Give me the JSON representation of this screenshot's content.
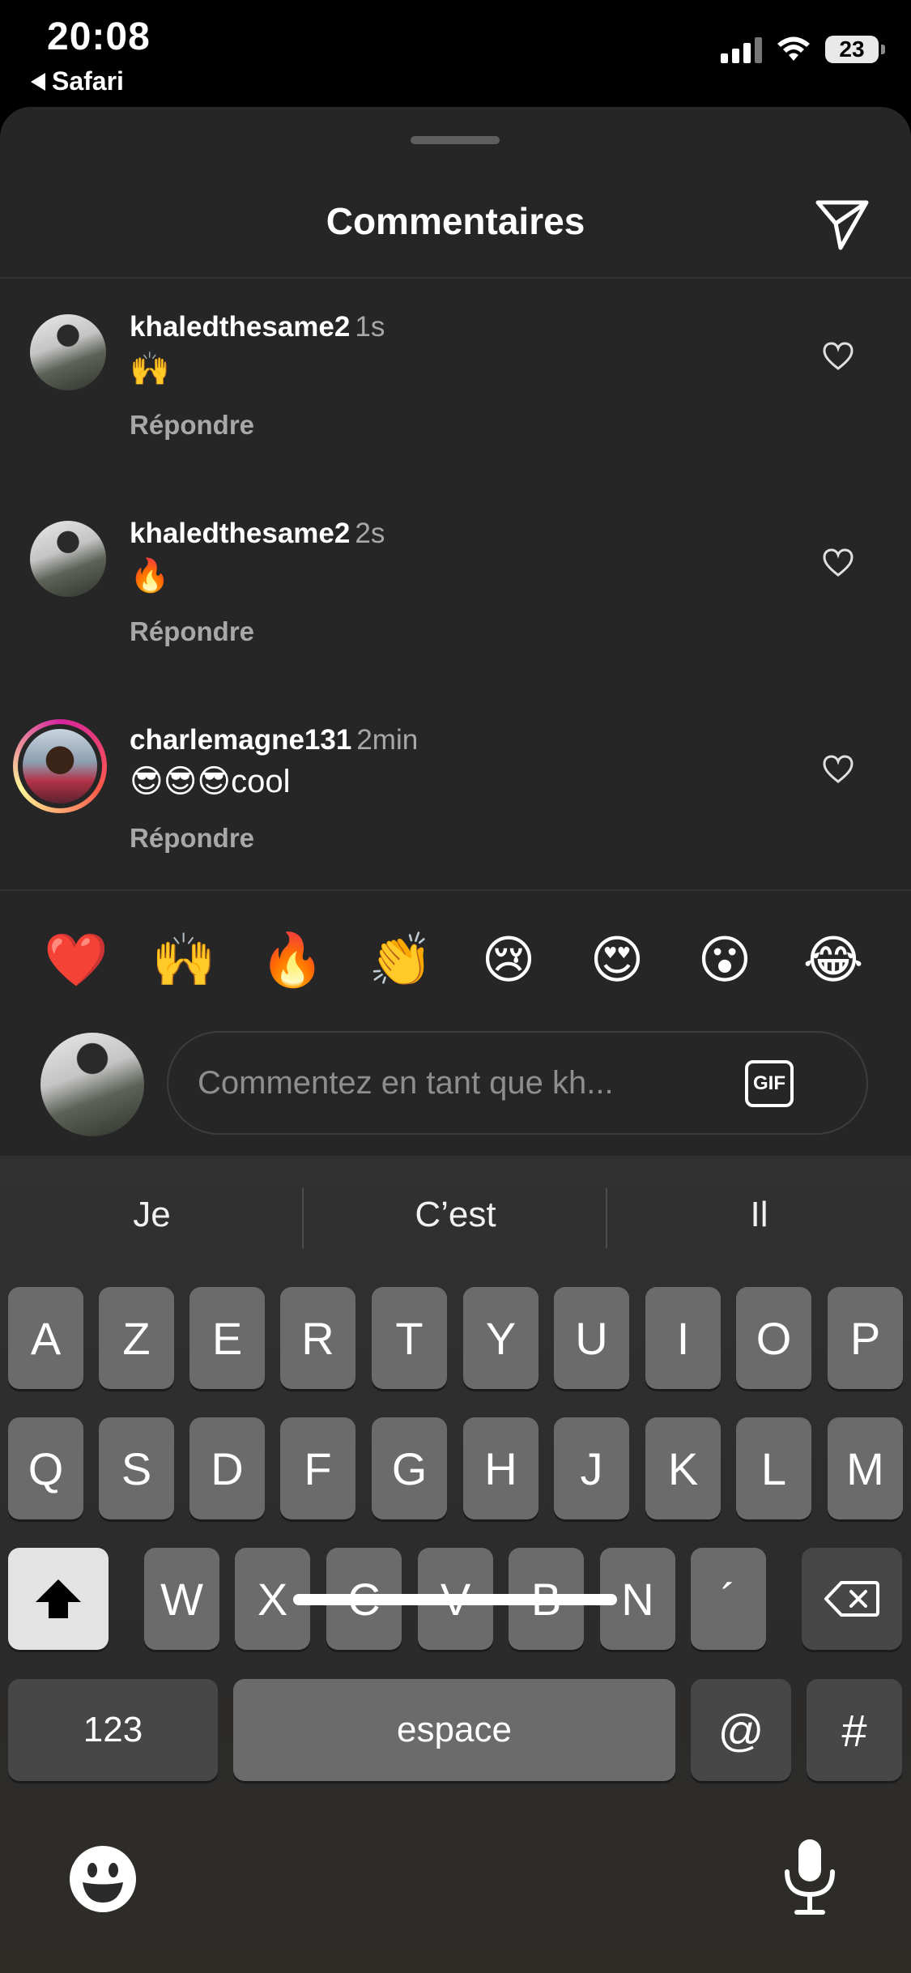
{
  "status_bar": {
    "time": "20:08",
    "back_label": "Safari",
    "battery": "23"
  },
  "sheet": {
    "title": "Commentaires",
    "reply_label": "Répondre"
  },
  "comments": [
    {
      "user": "khaledthesame2",
      "time": "1s",
      "text": "🙌"
    },
    {
      "user": "khaledthesame2",
      "time": "2s",
      "text": "🔥"
    },
    {
      "user": "charlemagne131",
      "time": "2min",
      "text": "😎😎😎cool"
    }
  ],
  "emoji_bar": [
    "❤️",
    "🙌",
    "🔥",
    "👏",
    "😢",
    "😍",
    "😮",
    "😂"
  ],
  "composer": {
    "placeholder": "Commentez en tant que kh...",
    "gif_label": "GIF"
  },
  "keyboard": {
    "suggestions": [
      "Je",
      "C’est",
      "Il"
    ],
    "row1": [
      "A",
      "Z",
      "E",
      "R",
      "T",
      "Y",
      "U",
      "I",
      "O",
      "P"
    ],
    "row2": [
      "Q",
      "S",
      "D",
      "F",
      "G",
      "H",
      "J",
      "K",
      "L",
      "M"
    ],
    "row3": [
      "W",
      "X",
      "C",
      "V",
      "B",
      "N",
      "´"
    ],
    "numbers_label": "123",
    "space_label": "espace",
    "at_label": "@",
    "hash_label": "#"
  },
  "colors": {
    "sheet_bg": "#262626",
    "secondary_text": "#a8a8a8",
    "key_bg": "#6b6b6b"
  },
  "icons": [
    "send-icon",
    "heart-icon",
    "gif-icon",
    "shift-icon",
    "delete-icon",
    "emoji-keyboard-icon",
    "microphone-icon"
  ]
}
